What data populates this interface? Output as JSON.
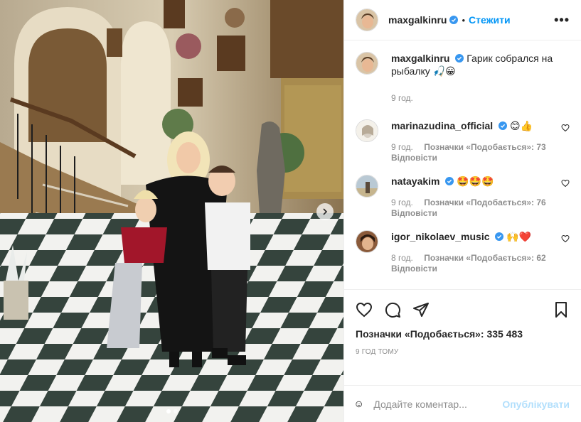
{
  "post": {
    "author": "maxgalkinru",
    "separator": "•",
    "follow_label": "Стежити",
    "more_label": "•••",
    "caption_text": "Гарик собрался на рыбалку 🎣😀",
    "caption_time": "9 год."
  },
  "comments": [
    {
      "user": "marinazudina_official",
      "text": "😊👍",
      "time": "9 год.",
      "likes": "Позначки «Подобається»: 73",
      "reply": "Відповісти"
    },
    {
      "user": "natayakim",
      "text": "🤩🤩🤩",
      "time": "9 год.",
      "likes": "Позначки «Подобається»: 76",
      "reply": "Відповісти"
    },
    {
      "user": "igor_nikolaev_music",
      "text": "🙌❤️",
      "time": "8 год.",
      "likes": "Позначки «Подобається»: 62",
      "reply": "Відповісти"
    }
  ],
  "actions": {
    "like_total": "Позначки «Подобається»: 335 483",
    "posted_ago": "9 ГОД ТОМУ"
  },
  "composer": {
    "placeholder": "Додайте коментар...",
    "publish_label": "Опублікувати"
  },
  "media": {
    "carousel_total": 2,
    "carousel_active": 1
  },
  "colors": {
    "link_blue": "#0095f6",
    "verified_blue": "#3897f0",
    "muted_gray": "#8e8e8e",
    "publish_disabled": "#b2dffc"
  }
}
